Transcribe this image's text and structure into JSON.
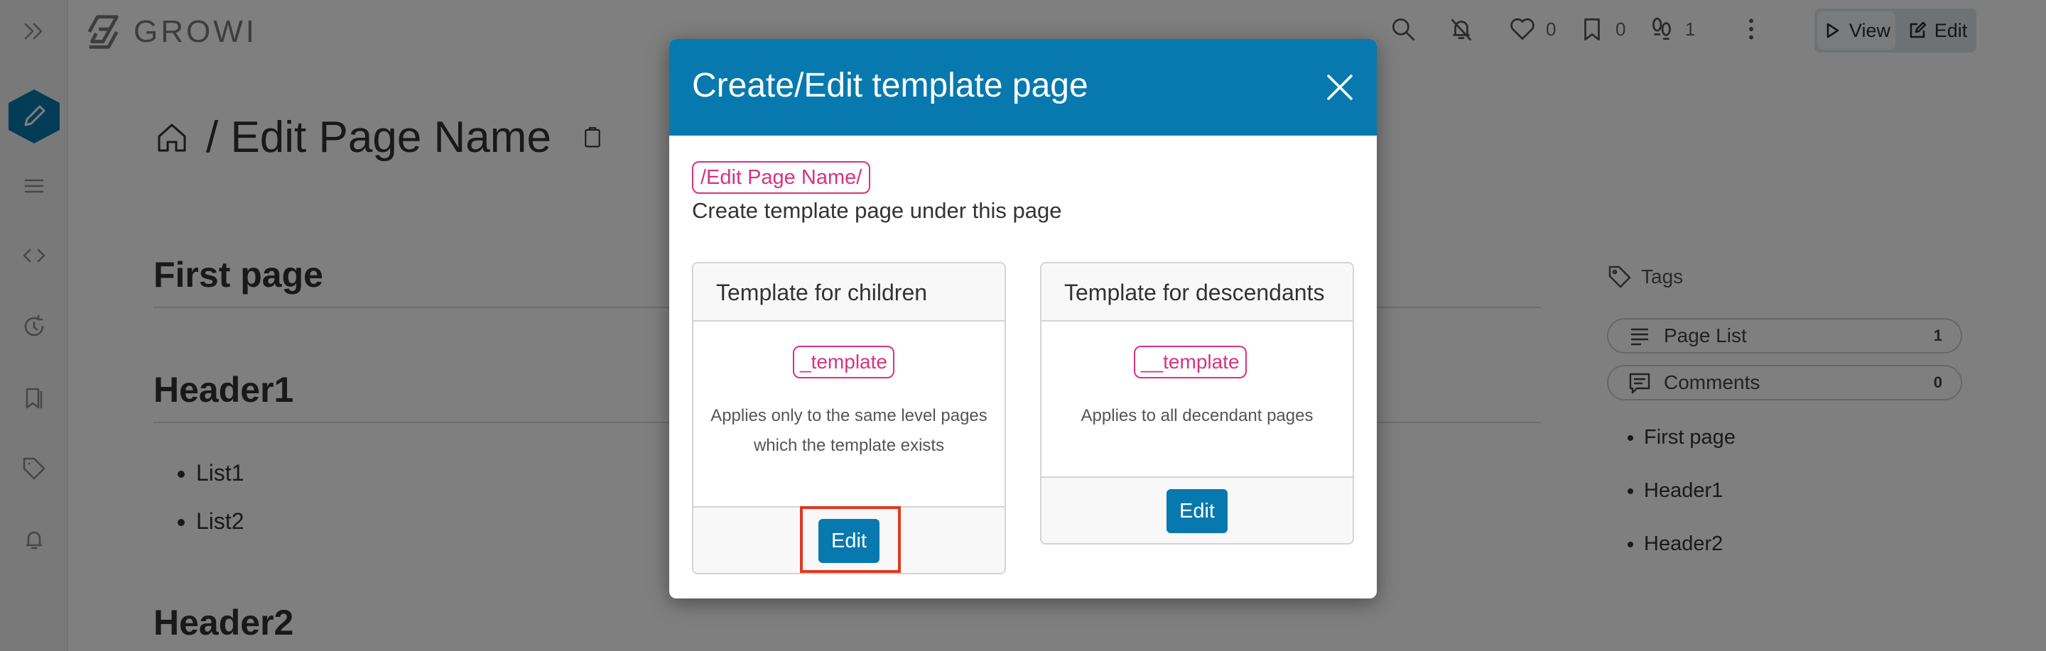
{
  "app": {
    "name": "GROWI"
  },
  "topbar": {
    "like_count": "0",
    "bookmark_count": "0",
    "seen_count": "1",
    "view_label": "View",
    "edit_label": "Edit"
  },
  "page": {
    "title": "/ Edit Page Name",
    "sections": [
      {
        "heading": "First page"
      },
      {
        "heading": "Header1",
        "items": [
          "List1",
          "List2"
        ]
      },
      {
        "heading": "Header2"
      }
    ]
  },
  "right_panel": {
    "tags_label": "Tags",
    "page_list_label": "Page List",
    "page_list_count": "1",
    "comments_label": "Comments",
    "comments_count": "0",
    "toc": [
      "First page",
      "Header1",
      "Header2"
    ]
  },
  "modal": {
    "title": "Create/Edit template page",
    "path": "/Edit Page Name/",
    "description": "Create template page under this page",
    "cards": [
      {
        "header": "Template for children",
        "badge": "_template",
        "text": "Applies only to the same level pages which the template exists",
        "button": "Edit",
        "highlighted": true
      },
      {
        "header": "Template for descendants",
        "badge": "__template",
        "text": "Applies to all decendant pages",
        "button": "Edit",
        "highlighted": false
      }
    ]
  },
  "colors": {
    "modal_header": "#0779ae",
    "badge": "#d6337f",
    "highlight": "#e03a1f"
  }
}
